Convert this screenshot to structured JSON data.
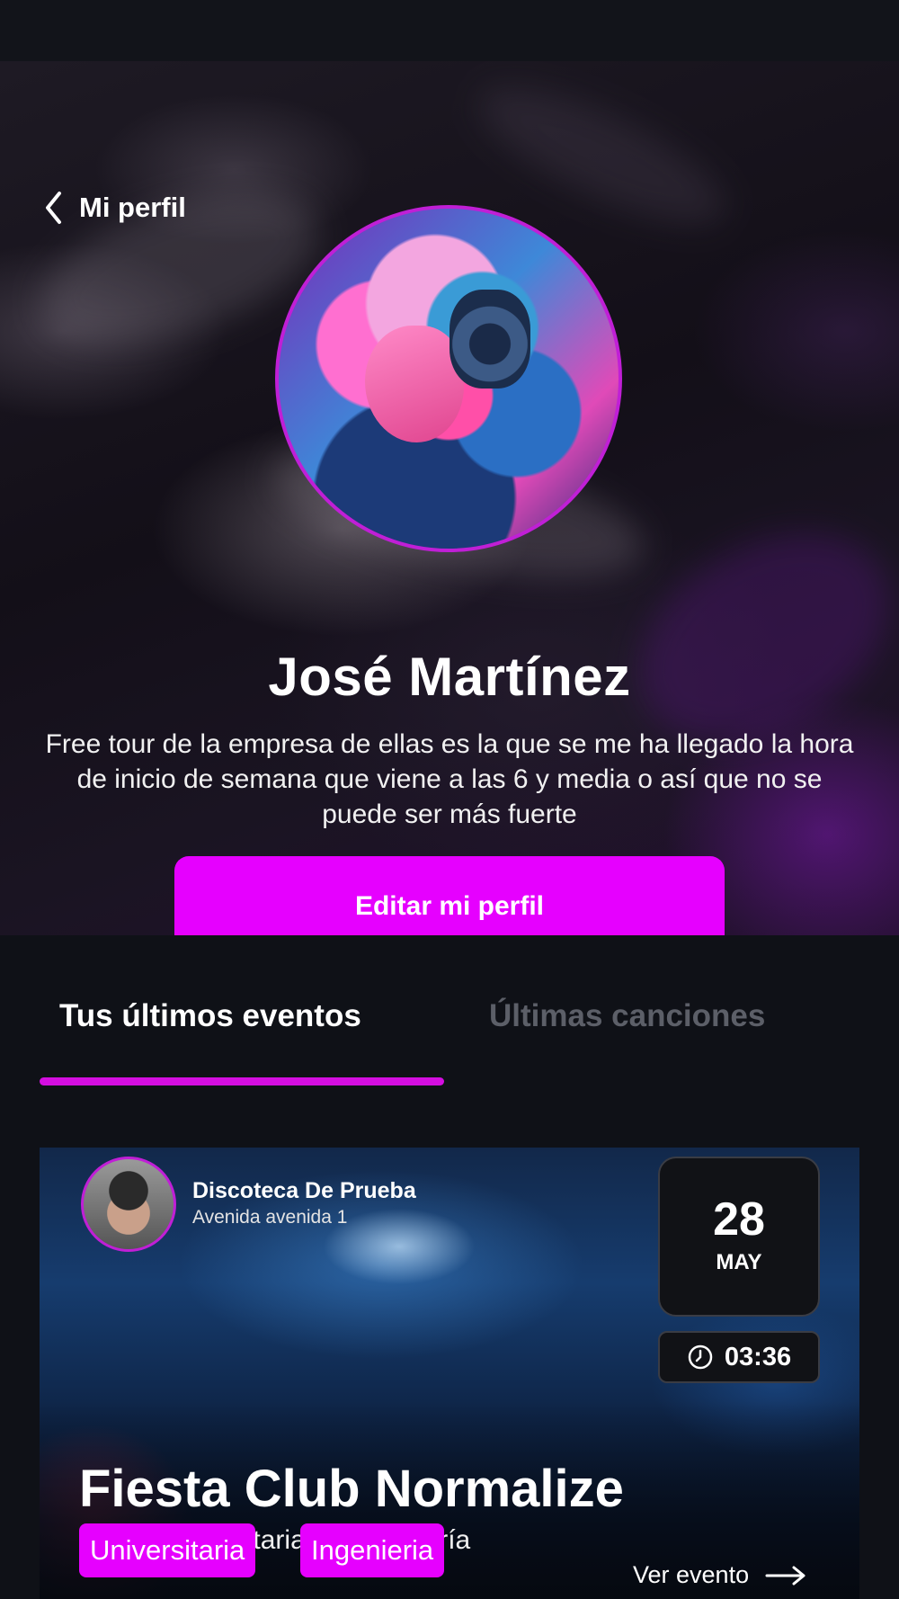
{
  "header": {
    "back_label": "Mi perfil"
  },
  "profile": {
    "name": "José Martínez",
    "bio": "Free tour de la empresa de ellas es la que se me ha llegado la hora de inicio de semana que viene a las 6 y media o así que no se puede ser más fuerte",
    "edit_button_label": "Editar mi perfil"
  },
  "tabs": [
    {
      "label": "Tus últimos eventos",
      "active": true
    },
    {
      "label": "Últimas canciones",
      "active": false
    }
  ],
  "event": {
    "venue_name": "Discoteca De Prueba",
    "venue_address": "Avenida avenida 1",
    "date_day": "28",
    "date_month": "MAY",
    "time": "03:36",
    "title": "Fiesta Club Normalize",
    "subtitle": "Fiesta universitaria de Ingeniería",
    "tags": [
      "Universitaria",
      "Ingenieria"
    ],
    "cta_label": "Ver evento"
  },
  "colors": {
    "accent": "#e600ff",
    "background": "#0f1117",
    "inactive_tab": "#5c5f68"
  }
}
